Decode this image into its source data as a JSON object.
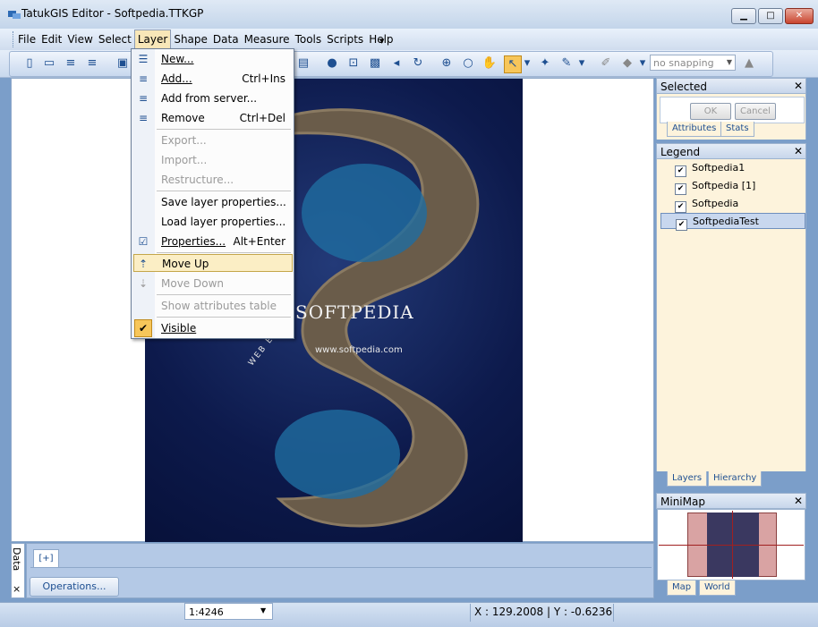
{
  "window": {
    "title": "TatukGIS Editor - Softpedia.TTKGP"
  },
  "menubar": [
    {
      "id": "file",
      "label": "File"
    },
    {
      "id": "edit",
      "label": "Edit"
    },
    {
      "id": "view",
      "label": "View"
    },
    {
      "id": "select",
      "label": "Select"
    },
    {
      "id": "layer",
      "label": "Layer"
    },
    {
      "id": "shape",
      "label": "Shape"
    },
    {
      "id": "data",
      "label": "Data"
    },
    {
      "id": "measure",
      "label": "Measure"
    },
    {
      "id": "tools",
      "label": "Tools"
    },
    {
      "id": "scripts",
      "label": "Scripts"
    },
    {
      "id": "help",
      "label": "Help"
    }
  ],
  "layer_menu": {
    "new": "New...",
    "add": "Add...",
    "add_shortcut": "Ctrl+Ins",
    "add_from_server": "Add from server...",
    "remove": "Remove",
    "remove_shortcut": "Ctrl+Del",
    "export": "Export...",
    "import": "Import...",
    "restructure": "Restructure...",
    "save_props": "Save layer properties...",
    "load_props": "Load layer properties...",
    "properties": "Properties...",
    "properties_shortcut": "Alt+Enter",
    "move_up": "Move Up",
    "move_down": "Move Down",
    "show_attr": "Show attributes table",
    "visible": "Visible"
  },
  "toolbar": {
    "snapping": "no snapping"
  },
  "map": {
    "watermark": "SOFTPEDIA",
    "watermark_url": "www.softpedia.com",
    "watermark_web": "WEB EN"
  },
  "selected_panel": {
    "title": "Selected",
    "ok": "OK",
    "cancel": "Cancel",
    "tabs": [
      "Attributes",
      "Stats"
    ]
  },
  "legend_panel": {
    "title": "Legend",
    "layers": [
      "Softpedia1",
      "Softpedia [1]",
      "Softpedia",
      "SoftpediaTest"
    ],
    "tabs": [
      "Layers",
      "Hierarchy"
    ]
  },
  "minimap_panel": {
    "title": "MiniMap",
    "tabs": [
      "Map",
      "World"
    ]
  },
  "bottom": {
    "data_tab": "Data",
    "plus_tab": "[+]",
    "operations": "Operations...",
    "close": "×"
  },
  "status": {
    "scale": "1:4246",
    "coords": "X : 129.2008 | Y : -0.6236"
  }
}
